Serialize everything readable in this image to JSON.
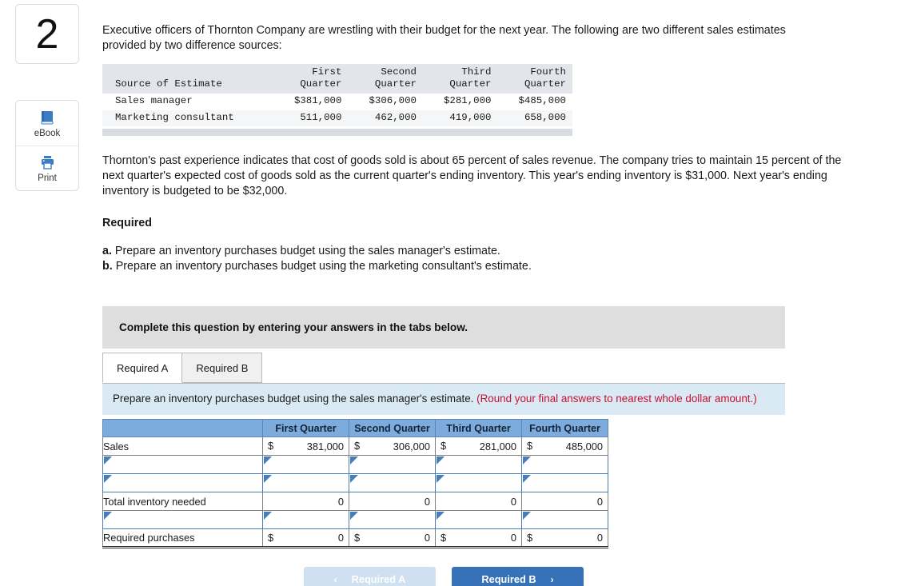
{
  "left_rail": {
    "question_number": "2",
    "tools": [
      {
        "label": "eBook",
        "icon": "book-icon"
      },
      {
        "label": "Print",
        "icon": "printer-icon"
      }
    ]
  },
  "question": {
    "intro": "Executive officers of Thornton Company are wrestling with their budget for the next year. The following are two different sales estimates provided by two difference sources:",
    "paragraph": "Thornton's past experience indicates that cost of goods sold is about 65 percent of sales revenue. The company tries to maintain 15 percent of the next quarter's expected cost of goods sold as the current quarter's ending inventory. This year's ending inventory is $31,000. Next year's ending inventory is budgeted to be $32,000.",
    "required_heading": "Required",
    "required_items": [
      {
        "marker": "a.",
        "text": "Prepare an inventory purchases budget using the sales manager's estimate."
      },
      {
        "marker": "b.",
        "text": "Prepare an inventory purchases budget using the marketing consultant's estimate."
      }
    ]
  },
  "estimate_table": {
    "headers": [
      "Source of Estimate",
      "First\nQuarter",
      "Second\nQuarter",
      "Third\nQuarter",
      "Fourth\nQuarter"
    ],
    "rows": [
      {
        "label": "Sales manager",
        "values": [
          "$381,000",
          "$306,000",
          "$281,000",
          "$485,000"
        ]
      },
      {
        "label": "Marketing consultant",
        "values": [
          "511,000",
          "462,000",
          "419,000",
          "658,000"
        ]
      }
    ]
  },
  "banner": {
    "text": "Complete this question by entering your answers in the tabs below."
  },
  "tabs": [
    {
      "label": "Required A",
      "active": true
    },
    {
      "label": "Required B",
      "active": false
    }
  ],
  "instruction": {
    "main": "Prepare an inventory purchases budget using the sales manager's estimate.",
    "note": "(Round your final answers to nearest whole dollar amount.)"
  },
  "answer_grid": {
    "headers": [
      "",
      "First Quarter",
      "Second Quarter",
      "Third Quarter",
      "Fourth Quarter"
    ],
    "rows": [
      {
        "type": "filled",
        "label": "Sales",
        "cells": [
          {
            "currency": "$",
            "value": "381,000"
          },
          {
            "currency": "$",
            "value": "306,000"
          },
          {
            "currency": "$",
            "value": "281,000"
          },
          {
            "currency": "$",
            "value": "485,000"
          }
        ]
      },
      {
        "type": "empty",
        "label": "",
        "cells": [
          null,
          null,
          null,
          null
        ]
      },
      {
        "type": "empty",
        "label": "",
        "cells": [
          null,
          null,
          null,
          null
        ]
      },
      {
        "type": "filled",
        "label": "Total inventory needed",
        "cells": [
          {
            "currency": "",
            "value": "0"
          },
          {
            "currency": "",
            "value": "0"
          },
          {
            "currency": "",
            "value": "0"
          },
          {
            "currency": "",
            "value": "0"
          }
        ]
      },
      {
        "type": "empty",
        "label": "",
        "cells": [
          null,
          null,
          null,
          null
        ]
      },
      {
        "type": "filled",
        "last": true,
        "label": "Required purchases",
        "cells": [
          {
            "currency": "$",
            "value": "0"
          },
          {
            "currency": "$",
            "value": "0"
          },
          {
            "currency": "$",
            "value": "0"
          },
          {
            "currency": "$",
            "value": "0"
          }
        ]
      }
    ]
  },
  "nav": {
    "prev_label": "Required A",
    "next_label": "Required B",
    "prev_chevron": "‹",
    "next_chevron": "›"
  },
  "colors": {
    "header_blue": "#7dabdb",
    "instruction_blue": "#d9eaf5",
    "note_red": "#c8102e",
    "next_button": "#3771b8",
    "prev_button": "#cfe0f0",
    "banner_grey": "#dededf"
  }
}
